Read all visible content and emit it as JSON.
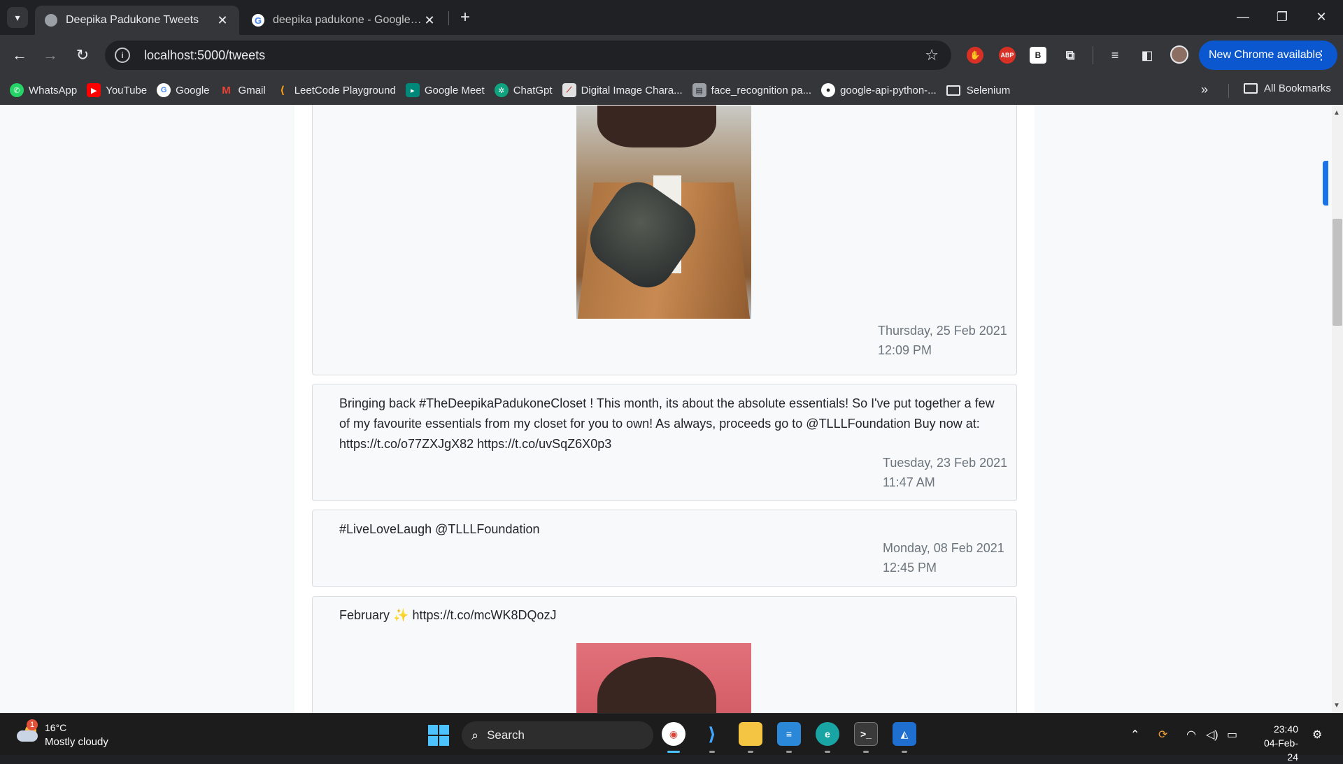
{
  "browser": {
    "tabs": [
      {
        "title": "Deepika Padukone Tweets",
        "active": true
      },
      {
        "title": "deepika padukone - Google Search",
        "active": false
      }
    ],
    "url": "localhost:5000/tweets",
    "update_label": "New Chrome available",
    "extensions": [
      "hand-icon",
      "ABP",
      "B",
      "puzzle-icon",
      "media-icon",
      "sidepanel-icon"
    ]
  },
  "bookmarks": [
    {
      "label": "WhatsApp",
      "icon": "whatsapp-icon",
      "color": "#25d366"
    },
    {
      "label": "YouTube",
      "icon": "youtube-icon",
      "color": "#ff0000"
    },
    {
      "label": "Google",
      "icon": "google-icon",
      "color": "#4285f4"
    },
    {
      "label": "Gmail",
      "icon": "gmail-icon",
      "color": "#ea4335"
    },
    {
      "label": "LeetCode Playground",
      "icon": "leetcode-icon",
      "color": "#ffa116"
    },
    {
      "label": "Google Meet",
      "icon": "meet-icon",
      "color": "#00897b"
    },
    {
      "label": "ChatGpt",
      "icon": "chatgpt-icon",
      "color": "#10a37f"
    },
    {
      "label": "Digital Image Chara...",
      "icon": "page-icon",
      "color": "#e0e0e0"
    },
    {
      "label": "face_recognition pa...",
      "icon": "doc-icon",
      "color": "#9aa0a6"
    },
    {
      "label": "google-api-python-...",
      "icon": "github-icon",
      "color": "#ffffff"
    },
    {
      "label": "Selenium",
      "icon": "folder-icon",
      "color": "#35363a"
    }
  ],
  "all_bookmarks_label": "All Bookmarks",
  "tweets": [
    {
      "text": "",
      "date": "Thursday, 25 Feb 2021",
      "time": "12:09 PM",
      "has_image": true
    },
    {
      "text": "Bringing back #TheDeepikaPadukoneCloset ! This month, its about the absolute essentials! So I've put together a few of my favourite essentials from my closet for you to own! As always, proceeds go to @TLLLFoundation Buy now at: https://t.co/o77ZXJgX82 https://t.co/uvSqZ6X0p3",
      "date": "Tuesday, 23 Feb 2021",
      "time": "11:47 AM"
    },
    {
      "text": "#LiveLoveLaugh @TLLLFoundation",
      "date": "Monday, 08 Feb 2021",
      "time": "12:45 PM"
    },
    {
      "text": "February ✨ https://t.co/mcWK8DQozJ",
      "date": "",
      "time": "",
      "has_image": true
    }
  ],
  "taskbar": {
    "weather_temp": "16°C",
    "weather_condition": "Mostly cloudy",
    "weather_badge": "1",
    "search_label": "Search",
    "time": "23:40",
    "date": "04-Feb-24"
  }
}
